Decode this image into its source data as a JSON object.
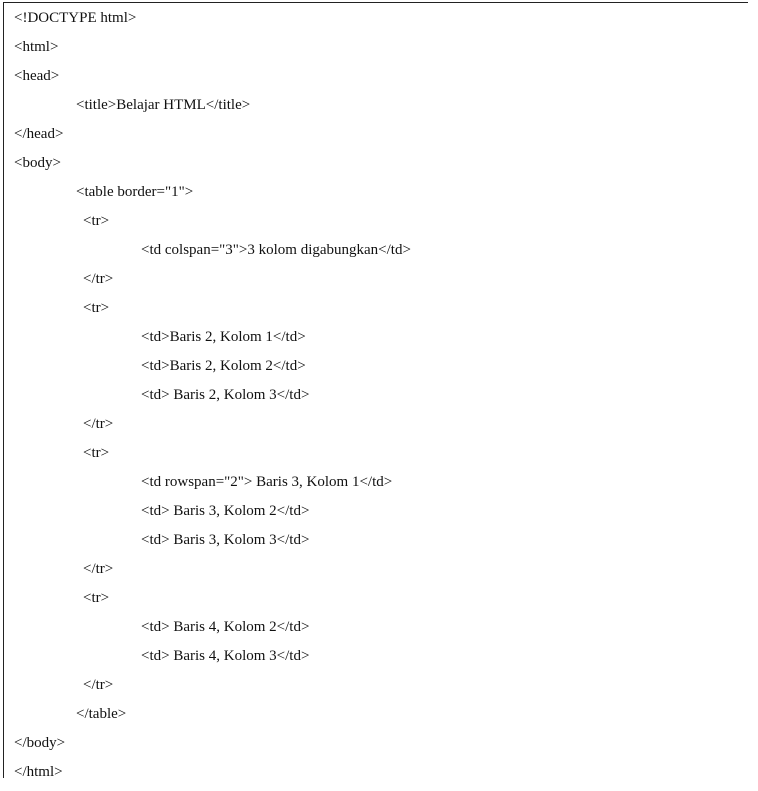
{
  "code": {
    "lines": [
      "<!DOCTYPE html>",
      "<html>",
      "<head>",
      "<title>Belajar HTML</title>",
      "</head>",
      "<body>",
      "<table border=\"1\">",
      "<tr>",
      "<td colspan=\"3\">3 kolom digabungkan</td>",
      "</tr>",
      "<tr>",
      "<td>Baris 2, Kolom 1</td>",
      "<td>Baris 2, Kolom 2</td>",
      "<td> Baris 2, Kolom 3</td>",
      "</tr>",
      "<tr>",
      "<td rowspan=\"2\"> Baris 3, Kolom 1</td>",
      "<td> Baris 3, Kolom 2</td>",
      "<td> Baris 3, Kolom 3</td>",
      "</tr>",
      "<tr>",
      "<td> Baris 4, Kolom 2</td>",
      "<td> Baris 4, Kolom 3</td>",
      "</tr>",
      "</table>",
      "</body>",
      "</html>"
    ]
  }
}
